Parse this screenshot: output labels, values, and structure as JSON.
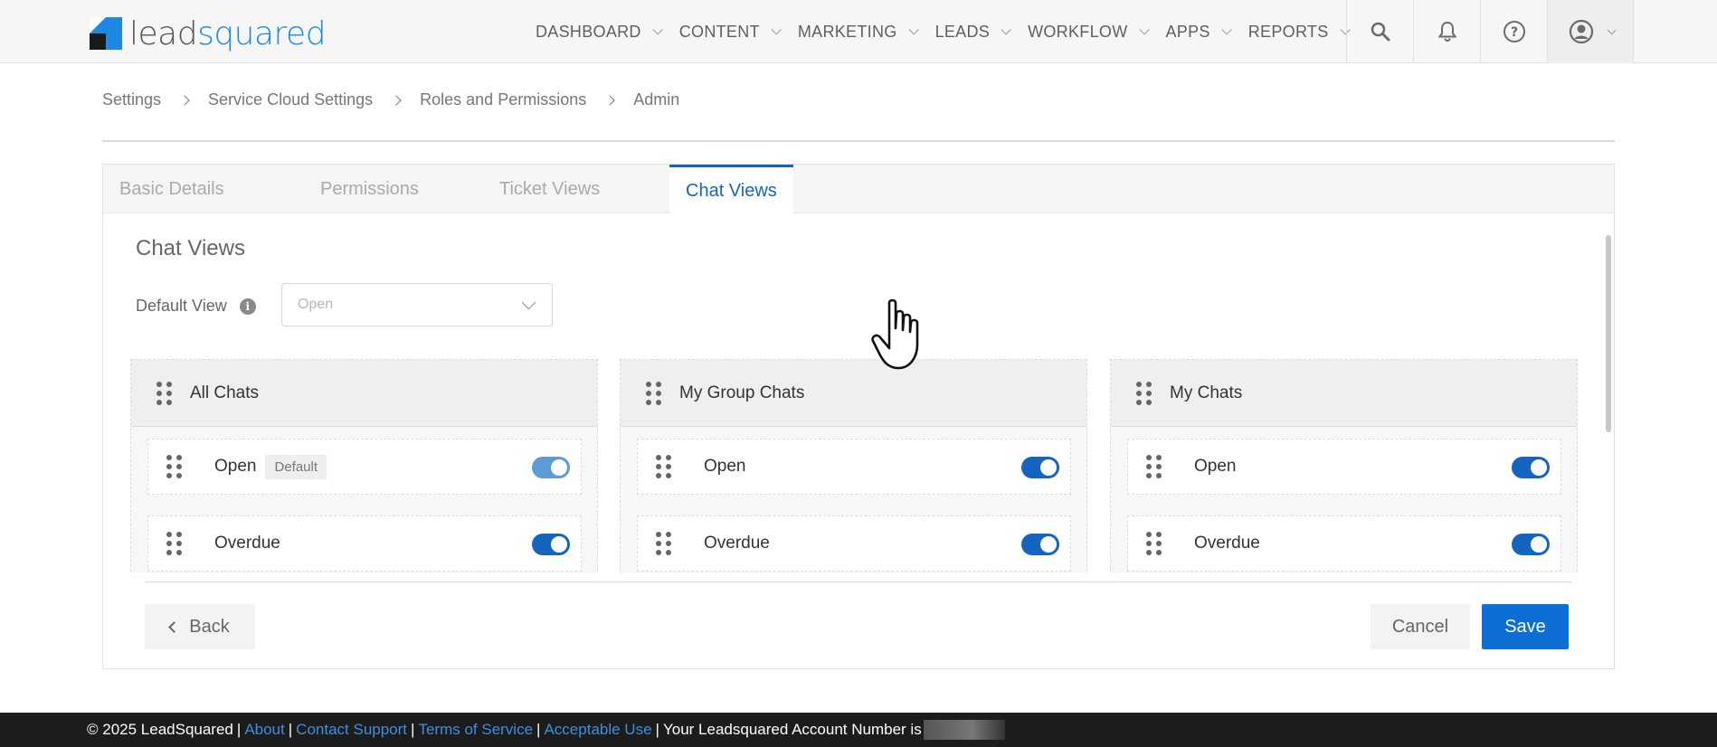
{
  "brand": {
    "logo_prefix": "lead",
    "logo_suffix": "squared",
    "accent_color": "#1565c0",
    "logo_color": "#1e88e5"
  },
  "nav": {
    "items": [
      {
        "label": "DASHBOARD"
      },
      {
        "label": "CONTENT"
      },
      {
        "label": "MARKETING"
      },
      {
        "label": "LEADS"
      },
      {
        "label": "WORKFLOW"
      },
      {
        "label": "APPS"
      },
      {
        "label": "REPORTS"
      }
    ],
    "icons": [
      "search-icon",
      "bell-icon",
      "help-icon",
      "user-profile-icon"
    ]
  },
  "breadcrumb": [
    "Settings",
    "Service Cloud Settings",
    "Roles and Permissions",
    "Admin"
  ],
  "tabs": [
    {
      "label": "Basic Details"
    },
    {
      "label": "Permissions"
    },
    {
      "label": "Ticket Views"
    },
    {
      "label": "Chat Views",
      "active": true
    }
  ],
  "section": {
    "title": "Chat Views",
    "default_view_label": "Default View",
    "default_view_placeholder": "Open"
  },
  "columns": [
    {
      "title": "All Chats",
      "rows": [
        {
          "label": "Open",
          "badge": "Default",
          "enabled": true
        },
        {
          "label": "Overdue",
          "badge": "",
          "enabled": true
        }
      ]
    },
    {
      "title": "My Group Chats",
      "rows": [
        {
          "label": "Open",
          "badge": "",
          "enabled": true
        },
        {
          "label": "Overdue",
          "badge": "",
          "enabled": true
        }
      ]
    },
    {
      "title": "My Chats",
      "rows": [
        {
          "label": "Open",
          "badge": "",
          "enabled": true
        },
        {
          "label": "Overdue",
          "badge": "",
          "enabled": true
        }
      ]
    }
  ],
  "actions": {
    "back_label": "Back",
    "cancel_label": "Cancel",
    "save_label": "Save"
  },
  "footer": {
    "copyright": "© 2025 LeadSquared",
    "links": [
      "About",
      "Contact Support",
      "Terms of Service",
      "Acceptable Use"
    ],
    "account_text": "Your Leadsquared Account Number is"
  }
}
